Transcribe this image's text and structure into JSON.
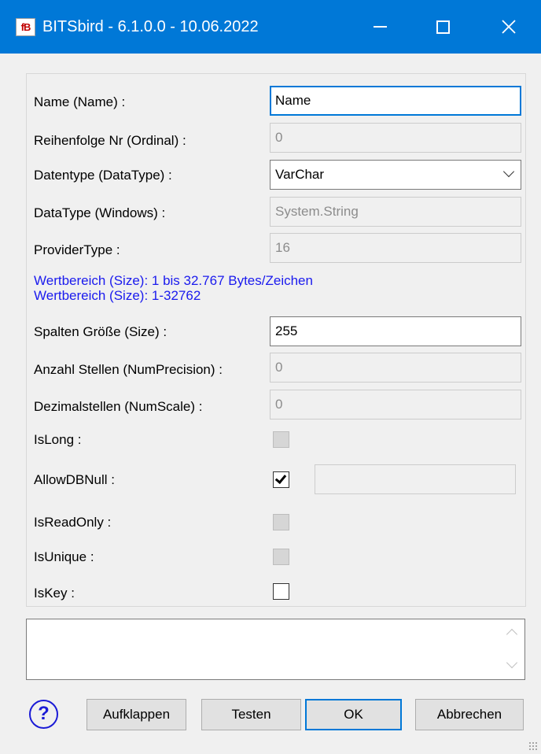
{
  "window": {
    "icon_text": "fB",
    "title": "BITSbird - 6.1.0.0 - 10.06.2022"
  },
  "fields": {
    "name": {
      "label": "Name (Name) :",
      "value": "Name"
    },
    "ordinal": {
      "label": "Reihenfolge Nr (Ordinal) :",
      "value": "0"
    },
    "datatype": {
      "label": "Datentype (DataType) :",
      "value": "VarChar"
    },
    "datatype_windows": {
      "label": "DataType (Windows) :",
      "value": "System.String"
    },
    "provider_type": {
      "label": "ProviderType :",
      "value": "16"
    },
    "info_line1": "Wertbereich (Size): 1 bis 32.767 Bytes/Zeichen",
    "info_line2": "Wertbereich (Size): 1-32762",
    "size": {
      "label": "Spalten Größe (Size) :",
      "value": "255"
    },
    "num_precision": {
      "label": "Anzahl Stellen (NumPrecision) :",
      "value": "0"
    },
    "num_scale": {
      "label": "Dezimalstellen (NumScale) :",
      "value": "0"
    }
  },
  "checkboxes": {
    "is_long": {
      "label": "IsLong :",
      "checked": false,
      "enabled": false
    },
    "allow_db_null": {
      "label": "AllowDBNull :",
      "checked": true,
      "enabled": true
    },
    "is_read_only": {
      "label": "IsReadOnly :",
      "checked": false,
      "enabled": false
    },
    "is_unique": {
      "label": "IsUnique :",
      "checked": false,
      "enabled": false
    },
    "is_key": {
      "label": "IsKey :",
      "checked": false,
      "enabled": true
    }
  },
  "buttons": {
    "help": "?",
    "aufklappen": "Aufklappen",
    "testen": "Testen",
    "ok": "OK",
    "abbrechen": "Abbrechen"
  }
}
